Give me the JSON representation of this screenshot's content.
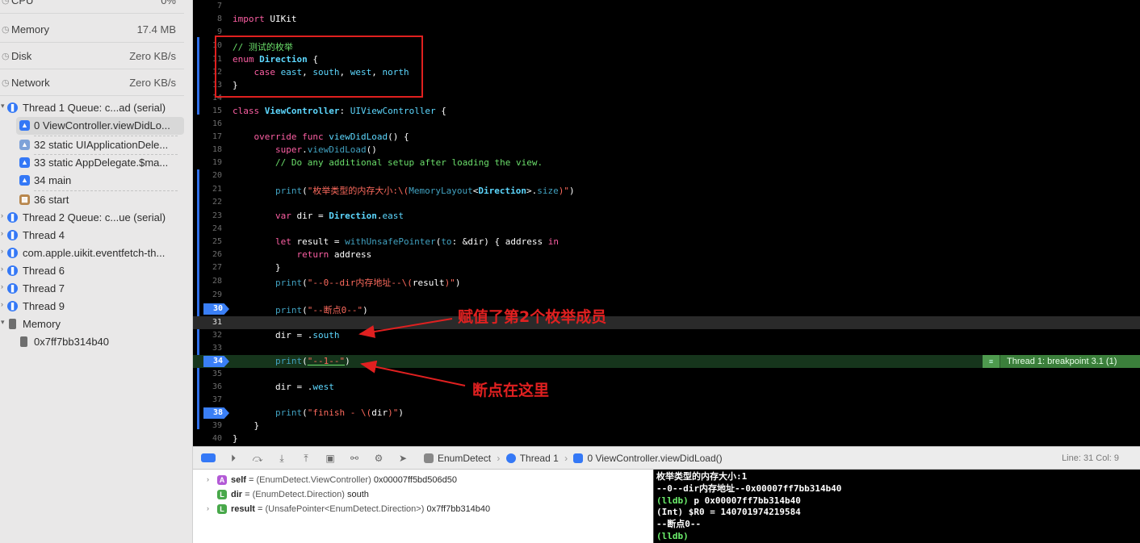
{
  "sidebar": {
    "gauges": [
      {
        "label": "CPU",
        "value": "0%"
      },
      {
        "label": "Memory",
        "value": "17.4 MB"
      },
      {
        "label": "Disk",
        "value": "Zero KB/s"
      },
      {
        "label": "Network",
        "value": "Zero KB/s"
      }
    ],
    "threads": [
      {
        "label": "Thread 1 Queue: c...ad (serial)",
        "type": "thread"
      },
      {
        "label": "0 ViewController.viewDidLo...",
        "type": "frame",
        "selected": true
      },
      {
        "label": "32 static UIApplicationDele...",
        "type": "frame"
      },
      {
        "label": "33 static AppDelegate.$ma...",
        "type": "frame"
      },
      {
        "label": "34 main",
        "type": "frame"
      },
      {
        "label": "36 start",
        "type": "frame-system"
      },
      {
        "label": "Thread 2 Queue: c...ue (serial)",
        "type": "thread"
      },
      {
        "label": "Thread 4",
        "type": "thread"
      },
      {
        "label": "com.apple.uikit.eventfetch-th...",
        "type": "thread"
      },
      {
        "label": "Thread 6",
        "type": "thread"
      },
      {
        "label": "Thread 7",
        "type": "thread"
      },
      {
        "label": "Thread 9",
        "type": "thread"
      },
      {
        "label": "Memory",
        "type": "memory"
      },
      {
        "label": "0x7ff7bb314b40",
        "type": "memory-item"
      }
    ]
  },
  "editor": {
    "line_numbers": [
      "7",
      "8",
      "9",
      "10",
      "11",
      "12",
      "13",
      "14",
      "15",
      "16",
      "17",
      "18",
      "19",
      "20",
      "21",
      "22",
      "23",
      "24",
      "25",
      "26",
      "27",
      "28",
      "29",
      "30",
      "31",
      "32",
      "33",
      "34",
      "35",
      "36",
      "37",
      "38",
      "39",
      "40"
    ],
    "breakpoints": [
      "30",
      "34",
      "38"
    ],
    "current_line": "31",
    "breakpoint_badge": "Thread 1: breakpoint 3.1 (1)",
    "tokens": {
      "import": "import",
      "uikit": "UIKit",
      "comment_enum": "// 测试的枚举",
      "enum": "enum",
      "direction": "Direction",
      "brace_open": " {",
      "case": "case",
      "east": "east",
      "south": "south",
      "west": "west",
      "north": "north",
      "brace_close": "}",
      "class": "class",
      "viewcontroller": "ViewController",
      "colon": ": ",
      "uiviewcontroller": "UIViewController",
      "override": "override",
      "func": "func",
      "viewdidload": "viewDidLoad",
      "parens_brace": "() {",
      "super": "super",
      "dot": ".",
      "parens": "()",
      "comment_setup": "// Do any additional setup after loading the view.",
      "print": "print",
      "paren_open": "(",
      "str_mem": "\"枚举类型的内存大小:\\(",
      "memorylayout": "MemoryLayout",
      "lt": "<",
      "gt_size": ">.",
      "size": "size",
      "str_close": ")\"",
      "paren_close": ")",
      "var": "var",
      "dir_assign": " dir = ",
      "let": "let",
      "result_assign": " result = ",
      "withunsafepointer": "withUnsafePointer",
      "to": "to",
      "to_rest": ": &dir) { address ",
      "in": "in",
      "return": "return",
      "address": " address",
      "str_addr": "\"--0--dir内存地址--\\(",
      "result": "result",
      "str_bp0": "\"--断点0--\"",
      "dir_eq": "dir = .",
      "str_1": "\"--1--\"",
      "str_finish": "\"finish - \\(",
      "dir": "dir"
    }
  },
  "annotations": {
    "south_note": "赋值了第2个枚举成员",
    "bp_note": "断点在这里"
  },
  "debug_bar": {
    "crumb_target": "EnumDetect",
    "crumb_thread": "Thread 1",
    "crumb_frame": "0 ViewController.viewDidLoad()",
    "line_col": "Line: 31  Col: 9"
  },
  "variables": [
    {
      "badge": "A",
      "name": "self",
      "eq": " = ",
      "type": "(EnumDetect.ViewController)",
      "value": " 0x00007ff5bd506d50",
      "expandable": true
    },
    {
      "badge": "L",
      "name": "dir",
      "eq": " = ",
      "type": "(EnumDetect.Direction)",
      "value": " south",
      "expandable": false
    },
    {
      "badge": "L",
      "name": "result",
      "eq": " = ",
      "type": "(UnsafePointer<EnumDetect.Direction>)",
      "value": " 0x7ff7bb314b40",
      "expandable": true
    }
  ],
  "console": {
    "lines": [
      {
        "text": "枚举类型的内存大小:1",
        "prompt": ""
      },
      {
        "text": "--0--dir内存地址--0x00007ff7bb314b40",
        "prompt": ""
      },
      {
        "text": " p 0x00007ff7bb314b40",
        "prompt": "(lldb)"
      },
      {
        "text": "(Int) $R0 = 140701974219584",
        "prompt": ""
      },
      {
        "text": "--断点0--",
        "prompt": ""
      },
      {
        "text": "",
        "prompt": "(lldb)"
      }
    ]
  }
}
